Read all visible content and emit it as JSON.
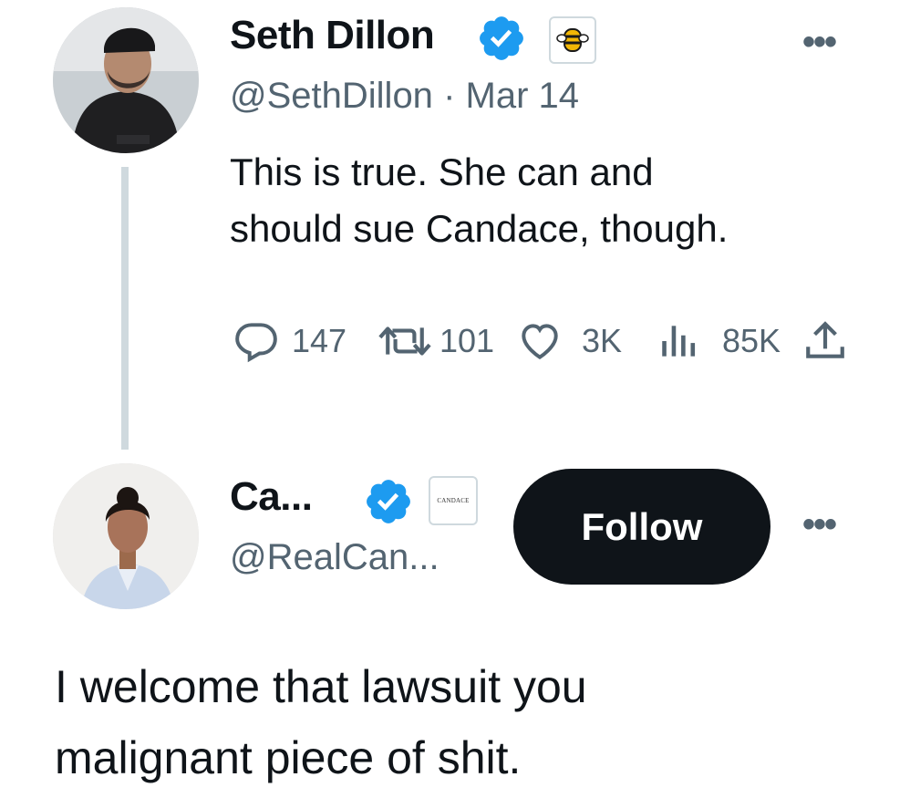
{
  "parent_tweet": {
    "author_name": "Seth Dillon",
    "handle": "@SethDillon",
    "separator": "·",
    "date": "Mar 14",
    "text_line1": "This is true. She can and",
    "text_line2": "should sue Candace, though.",
    "metrics": {
      "replies": "147",
      "retweets": "101",
      "likes": "3K",
      "views": "85K"
    }
  },
  "reply_tweet": {
    "author_name": "Ca...",
    "handle": "@RealCan...",
    "affiliate_badge_text": "CANDACE",
    "follow_label": "Follow",
    "text_line1": "I welcome that lawsuit you",
    "text_line2": "malignant piece of shit."
  },
  "icons": {
    "verified": "verified-badge-icon",
    "more": "more-options-icon",
    "reply": "reply-icon",
    "retweet": "retweet-icon",
    "like": "heart-icon",
    "views": "views-icon",
    "share": "share-icon"
  },
  "colors": {
    "verified_blue": "#1d9bf0",
    "text": "#0f1419",
    "secondary": "#536471",
    "follow_bg": "#0f1419"
  }
}
